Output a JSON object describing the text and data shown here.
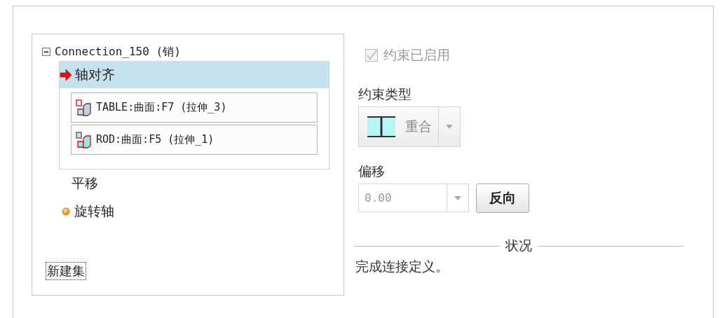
{
  "tree": {
    "label": "Connection_150 (销)",
    "expanded": true,
    "children": [
      {
        "label": "轴对齐",
        "selected": true,
        "kind": "arrow",
        "references": [
          {
            "label": "TABLE:曲面:F7 (拉伸_3)",
            "kind": "table"
          },
          {
            "label": "ROD:曲面:F5 (拉伸_1)",
            "kind": "rod"
          }
        ]
      },
      {
        "label": "平移",
        "selected": false,
        "kind": "plain"
      },
      {
        "label": "旋转轴",
        "selected": false,
        "kind": "dot"
      }
    ]
  },
  "new_set_link": "新建集",
  "constraint_enabled": {
    "label": "约束已启用",
    "checked": true,
    "disabled": true
  },
  "constraint_type": {
    "label": "约束类型",
    "value": "重合"
  },
  "offset": {
    "label": "偏移",
    "value": "0.00"
  },
  "flip_button": "反向",
  "status": {
    "title": "状况",
    "message": "完成连接定义。"
  }
}
